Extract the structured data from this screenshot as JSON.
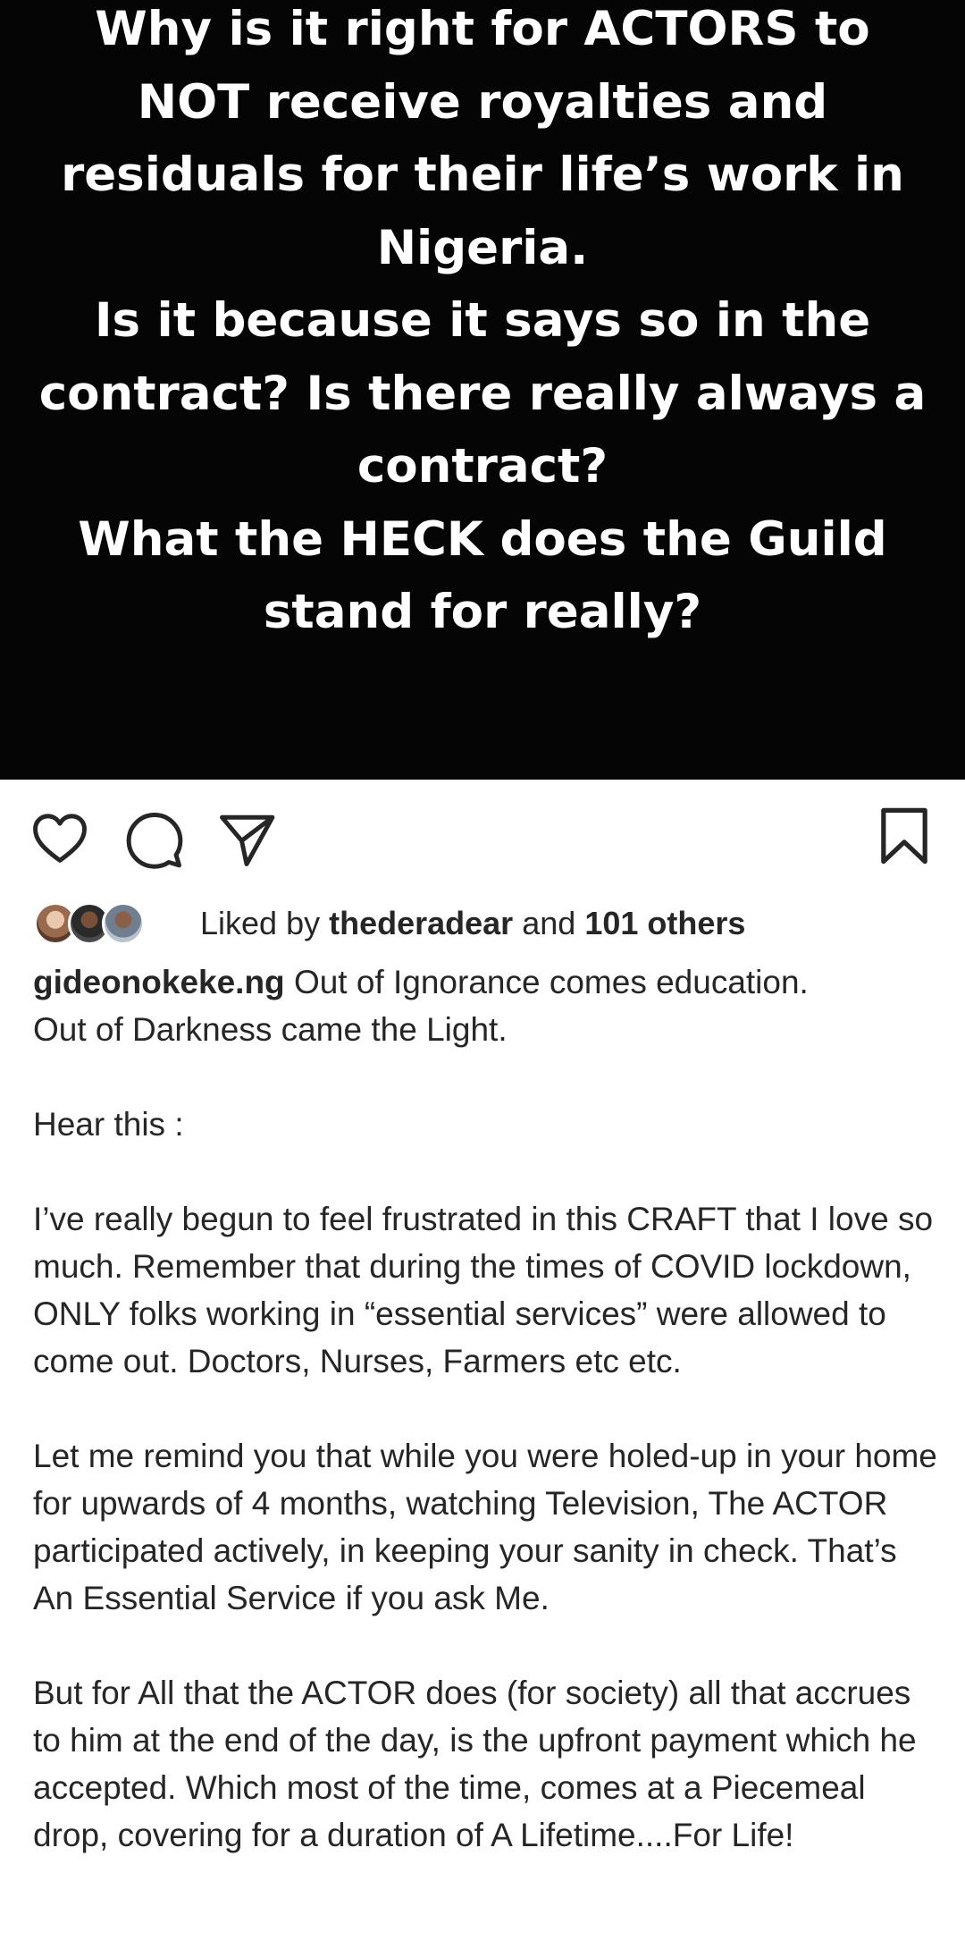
{
  "post_image": {
    "lines": [
      "Why is it right for ACTORS to NOT receive royalties and residuals for their life’s work in Nigeria.",
      "Is it because it says so in the contract? Is there really always a contract?",
      "What the HECK does the Guild stand for really?"
    ],
    "background": "#050505",
    "text_color": "#ffffff"
  },
  "actions": {
    "like_icon": "heart-outline",
    "comment_icon": "speech-bubble",
    "share_icon": "paper-plane",
    "save_icon": "bookmark-outline"
  },
  "likes": {
    "prefix": "Liked by",
    "first_liker": "thederadear",
    "connector": "and",
    "others": "101 others"
  },
  "caption": {
    "username": "gideonokeke.ng",
    "paragraphs": [
      "Out of Ignorance comes education.\nOut of Darkness came the Light.",
      "Hear this :",
      "I’ve really begun to feel frustrated in this CRAFT that I love so much. Remember that during the times of COVID lockdown, ONLY folks working in “essential services” were allowed to come out. Doctors, Nurses, Farmers etc etc.",
      "Let me remind you that while you were holed-up in your home for upwards of 4 months, watching Television, The ACTOR participated actively, in keeping your sanity in check. That’s An Essential Service if you ask Me.",
      "But for All that the ACTOR does (for society) all that accrues to him at the end of the day, is the upfront payment which he accepted. Which most of the time, comes at a Piecemeal drop, covering for a duration of A Lifetime....For Life!"
    ]
  }
}
